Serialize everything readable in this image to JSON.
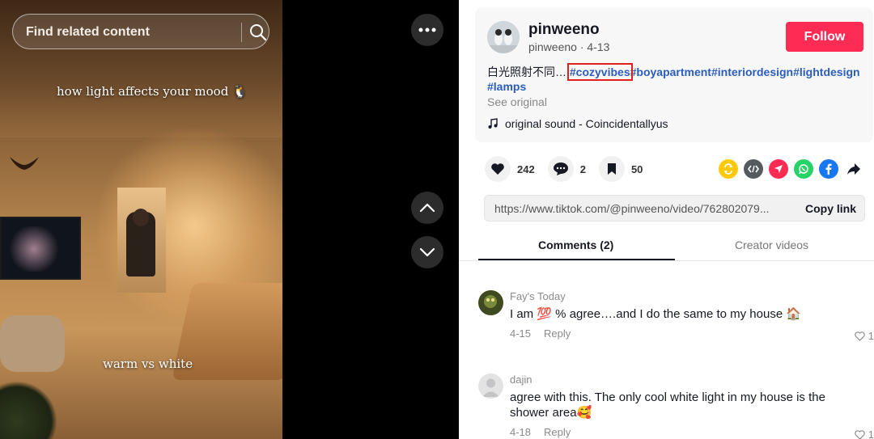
{
  "video": {
    "search_placeholder": "Find related content",
    "overlay_top": "how light affects your mood 🐧",
    "overlay_bottom": "warm vs white"
  },
  "author": {
    "name": "pinweeno",
    "handle": "pinweeno",
    "date": "4-13",
    "follow_label": "Follow"
  },
  "description": {
    "text": "白光照射不同…",
    "tags": [
      "#cozyvibes",
      "#boyapartment",
      "#interiordesign",
      "#lightdesign",
      "#lamps"
    ],
    "see_original": "See original",
    "sound": "original sound - Coincidentallyus"
  },
  "stats": {
    "likes": "242",
    "comments": "2",
    "saves": "50"
  },
  "share_icons": [
    "repost-icon",
    "embed-icon",
    "send-icon",
    "whatsapp-icon",
    "facebook-icon",
    "share-arrow-icon"
  ],
  "link": {
    "url": "https://www.tiktok.com/@pinweeno/video/762802079...",
    "copy_label": "Copy link"
  },
  "tabs": {
    "comments": "Comments (2)",
    "creator": "Creator videos"
  },
  "comments": [
    {
      "user": "Fay's Today",
      "text": "I am 💯 % agree….and I do the same to my house 🏠",
      "date": "4-15",
      "reply": "Reply",
      "likes": "1"
    },
    {
      "user": "dajin",
      "text": "agree with this. The only cool white light in my house is the shower area🥰",
      "date": "4-18",
      "reply": "Reply",
      "likes": "1"
    }
  ],
  "colors": {
    "follow": "#fe2c55",
    "hashtag": "#2b5db9",
    "highlight": "#e0201c"
  }
}
